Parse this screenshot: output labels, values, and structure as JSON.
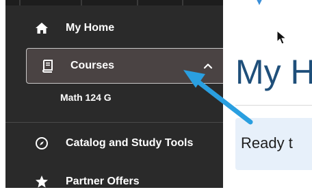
{
  "sidebar": {
    "items": [
      {
        "label": "My Home",
        "icon": "home-icon"
      },
      {
        "label": "Courses",
        "icon": "book-icon",
        "expanded": true
      },
      {
        "label": "Catalog and Study Tools",
        "icon": "compass-icon"
      },
      {
        "label": "Partner Offers",
        "icon": "star-icon"
      }
    ],
    "courses_children": [
      {
        "label": "Math 124 G"
      }
    ]
  },
  "main": {
    "title": "My H",
    "ready_text": "Ready t"
  },
  "colors": {
    "sidebar_bg": "#2a2a2a",
    "selected_bg": "#4a4343",
    "title_color": "#1f4f7a",
    "callout_arrow": "#2a9fe0",
    "ready_box_bg": "#e7f0fa"
  }
}
